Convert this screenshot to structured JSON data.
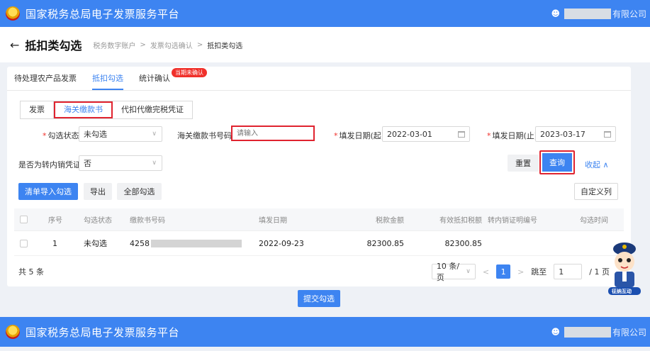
{
  "app": {
    "title": "国家税务总局电子发票服务平台",
    "user_suffix": "有限公司",
    "user_suffix_2": "有限公司"
  },
  "header": {
    "back_arrow": "←",
    "page_title": "抵扣类勾选",
    "breadcrumb": [
      "税务数字账户",
      "发票勾选确认",
      "抵扣类勾选"
    ],
    "separator": ">"
  },
  "tabs": [
    {
      "label": "待处理农产品发票"
    },
    {
      "label": "抵扣勾选"
    },
    {
      "label": "统计确认"
    }
  ],
  "tab_badge": "当期未确认",
  "subtabs": [
    {
      "label": "发票"
    },
    {
      "label": "海关缴款书"
    },
    {
      "label": "代扣代缴完税凭证"
    }
  ],
  "filters": {
    "status_label": "勾选状态",
    "status_value": "未勾选",
    "number_label": "海关缴款书号码",
    "number_placeholder": "请输入",
    "start_label": "填发日期(起)",
    "start_value": "2022-03-01",
    "end_label": "填发日期(止)",
    "end_value": "2023-03-17",
    "transfer_label": "是否为转内销凭证",
    "transfer_value": "否"
  },
  "buttons": {
    "reset": "重置",
    "query": "查询",
    "collapse": "收起 ∧",
    "import": "清单导入勾选",
    "export": "导出",
    "select_all": "全部勾选",
    "custom_columns": "自定义列",
    "submit": "提交勾选"
  },
  "table": {
    "columns": [
      "序号",
      "勾选状态",
      "缴款书号码",
      "填发日期",
      "税款金额",
      "有效抵扣税额",
      "转内销证明编号",
      "勾选时间"
    ],
    "rows": [
      {
        "index": "1",
        "status": "未勾选",
        "number_prefix": "4258",
        "date": "2022-09-23",
        "tax": "82300.85",
        "deductible": "82300.85",
        "transfer_no": "",
        "time": ""
      }
    ]
  },
  "pagination": {
    "total": "共 5 条",
    "page_size": "10 条/页",
    "prev": "<",
    "current": "1",
    "next": ">",
    "jump_label": "跳至",
    "jump_value": "1",
    "page_total": "/ 1 页"
  },
  "mascot_label": "征纳互动",
  "icons": {
    "user": "user-icon",
    "calendar": "calendar-icon",
    "chevron": "chevron-down-icon"
  },
  "colors": {
    "primary": "#3d84f1",
    "highlight": "#e0232f",
    "badge": "#f0302a"
  }
}
